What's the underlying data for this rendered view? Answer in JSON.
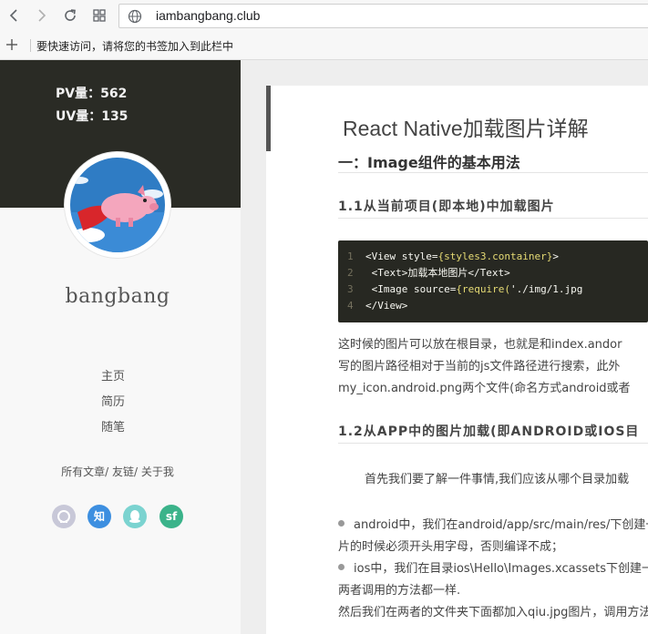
{
  "browser": {
    "url": "iambangbang.club",
    "bookmarks_hint": "要快速访问，请将您的书签加入到此栏中"
  },
  "sidebar": {
    "stats": {
      "pv": "PV量：562",
      "uv": "UV量：135"
    },
    "blog_name": "bangbang",
    "menu": [
      "主页",
      "简历",
      "随笔"
    ],
    "links": "所有文章/ 友链/ 关于我",
    "social": [
      {
        "name": "github",
        "label": "",
        "color": "#c8c8d8"
      },
      {
        "name": "zhihu",
        "label": "知",
        "color": "#3d8fe0"
      },
      {
        "name": "qq",
        "label": "",
        "color": "#7bd3d0"
      },
      {
        "name": "segmentfault",
        "label": "sf",
        "color": "#3bb38a"
      }
    ]
  },
  "article": {
    "title": "React Native加载图片详解",
    "h2": "一：Image组件的基本用法",
    "h3_1": "1.1从当前项目(即本地)中加载图片",
    "code": [
      {
        "num": "1",
        "parts": [
          [
            "t",
            "<View style="
          ],
          [
            "a",
            "{styles3.container}"
          ],
          [
            "t",
            ">"
          ]
        ]
      },
      {
        "num": "2",
        "parts": [
          [
            "t",
            "        <Text>加载本地图片</Text>"
          ]
        ]
      },
      {
        "num": "3",
        "parts": [
          [
            "t",
            "        <Image source="
          ],
          [
            "a",
            "{require("
          ],
          [
            "t",
            "'./img/1.jpg"
          ]
        ]
      },
      {
        "num": "4",
        "parts": [
          [
            "t",
            "</View>"
          ]
        ]
      }
    ],
    "p1": [
      "这时候的图片可以放在根目录，也就是和index.andor",
      "写的图片路径相对于当前的js文件路径进行搜索，此外",
      "my_icon.android.png两个文件(命名方式android或者"
    ],
    "h3_2": "1.2从APP中的图片加载(即ANDROID或IOS目",
    "p2": "首先我们要了解一件事情,我们应该从哪个目录加载",
    "bullet1": [
      "android中，我们在android/app/src/main/res/下创建一",
      "片的时候必须开头用字母，否则编译不成；"
    ],
    "bullet2": [
      "ios中，我们在目录ios\\Hello\\Images.xcassets下创建一个",
      "两者调用的方法都一样."
    ],
    "p3": "然后我们在两者的文件夹下面都加入qiu.jpg图片，调用方法为"
  }
}
